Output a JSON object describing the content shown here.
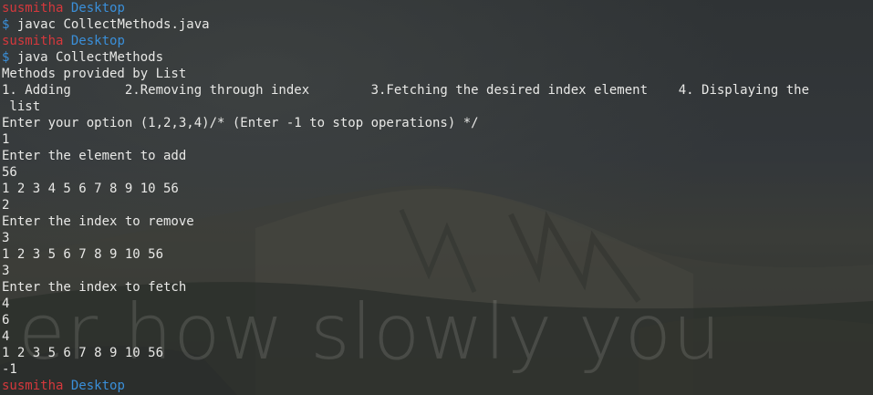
{
  "terminal": {
    "prompt_user": "susmitha",
    "prompt_dir": "Desktop",
    "prompt_symbol": "$",
    "wallpaper_caption": "er how slowly you",
    "colors": {
      "user": "#d5383c",
      "dir": "#3a8fd9",
      "text": "#e8e8e6",
      "background": "#2e3234"
    },
    "commands": [
      "javac CollectMethods.java",
      "java CollectMethods"
    ],
    "output": [
      "Methods provided by List",
      "1. Adding       2.Removing through index        3.Fetching the desired index element    4. Displaying the",
      " list",
      "Enter your option (1,2,3,4)/* (Enter -1 to stop operations) */",
      "1",
      "Enter the element to add",
      "56",
      "1 2 3 4 5 6 7 8 9 10 56",
      "2",
      "Enter the index to remove",
      "3",
      "1 2 3 5 6 7 8 9 10 56",
      "3",
      "Enter the index to fetch",
      "4",
      "6",
      "4",
      "1 2 3 5 6 7 8 9 10 56",
      "-1"
    ]
  }
}
